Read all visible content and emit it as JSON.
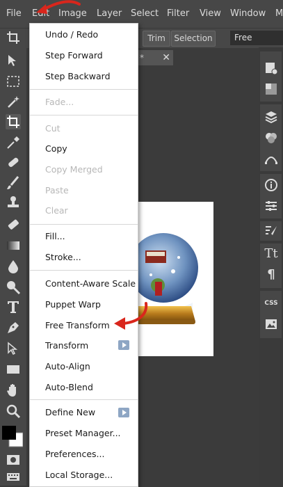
{
  "menubar": {
    "items": [
      "File",
      "Edit",
      "Image",
      "Layer",
      "Select",
      "Filter",
      "View",
      "Window",
      "M"
    ]
  },
  "options": {
    "trim_label": "Trim",
    "selection_label": "Selection",
    "ratio_value": "Free"
  },
  "document": {
    "tab_label": "*",
    "close_glyph": "✕"
  },
  "edit_menu": {
    "undo_redo": "Undo / Redo",
    "step_forward": "Step Forward",
    "step_backward": "Step Backward",
    "fade": "Fade...",
    "cut": "Cut",
    "copy": "Copy",
    "copy_merged": "Copy Merged",
    "paste": "Paste",
    "clear": "Clear",
    "fill": "Fill...",
    "stroke": "Stroke...",
    "content_aware_scale": "Content-Aware Scale",
    "puppet_warp": "Puppet Warp",
    "free_transform": "Free Transform",
    "transform": "Transform",
    "auto_align": "Auto-Align",
    "auto_blend": "Auto-Blend",
    "define_new": "Define New",
    "preset_manager": "Preset Manager...",
    "preferences": "Preferences...",
    "local_storage": "Local Storage..."
  },
  "right_panel": {
    "css_label": "CSS",
    "char_label": "Tt",
    "para_label": "¶",
    "info_label": "i"
  },
  "colors": {
    "annotation_arrow": "#d9261c",
    "menu_bg": "#ffffff",
    "app_bg": "#3b3b3b"
  }
}
